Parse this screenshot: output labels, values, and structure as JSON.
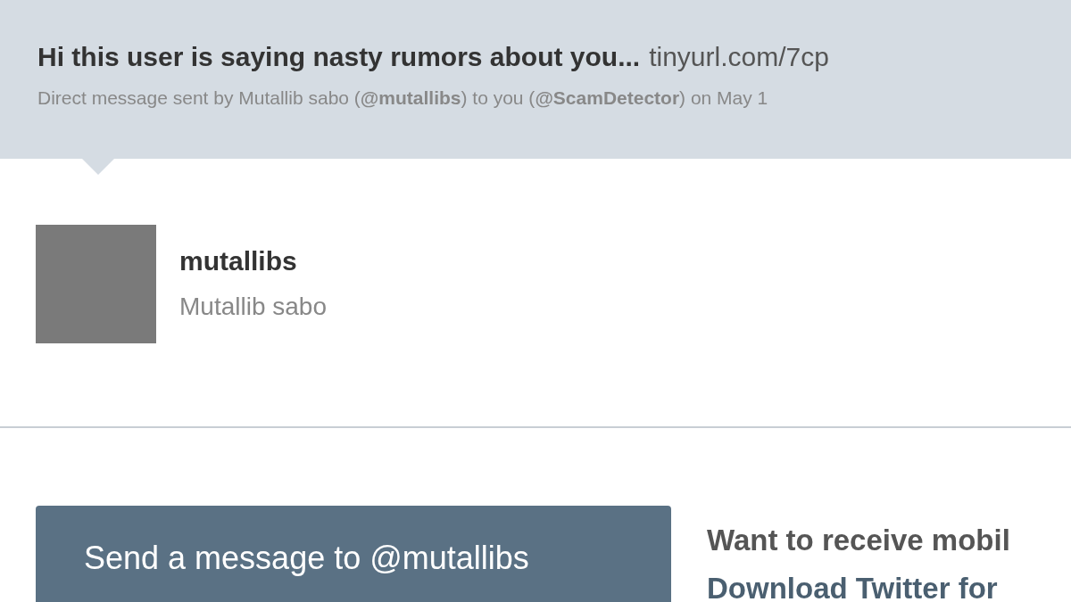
{
  "message": {
    "text": "Hi this user is saying nasty rumors about you...",
    "link": "tinyurl.com/7cp",
    "meta": "Direct message sent by Mutallib sabo (**@mutallibs**) to you (**@ScamDetector**) on May 1"
  },
  "sender": {
    "username": "mutallibs",
    "full_name": "Mutallib sabo"
  },
  "reply_button": "Send a message to @mutallibs",
  "promo": {
    "line_1": "Want to receive mobil",
    "line_2": "Download Twitter for"
  }
}
